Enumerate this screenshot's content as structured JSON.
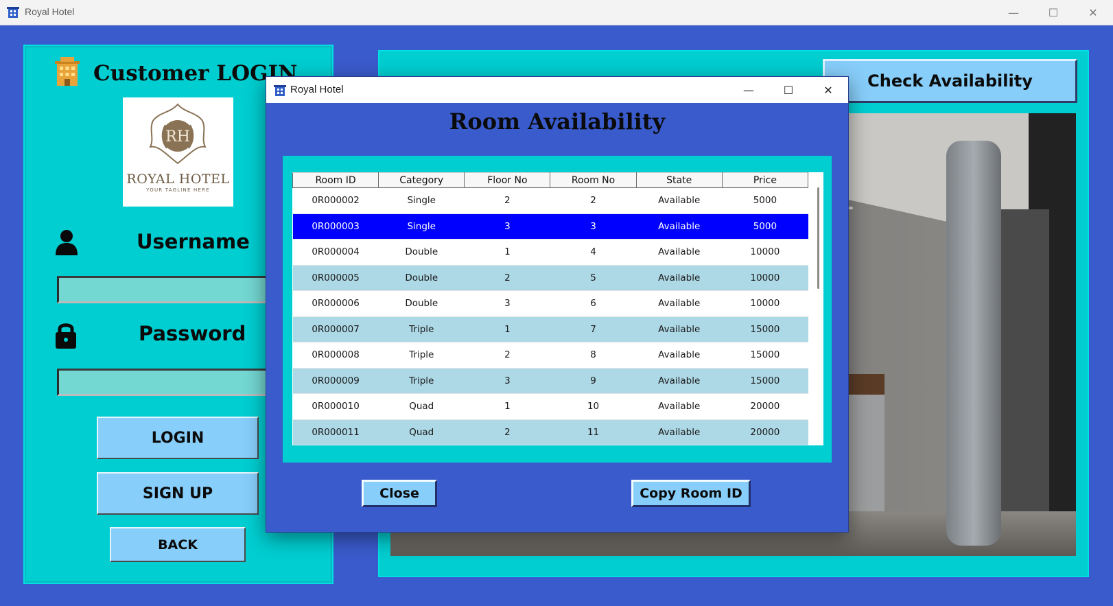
{
  "window": {
    "title": "Royal Hotel",
    "minimize_glyph": "—",
    "maximize_glyph": "☐",
    "close_glyph": "✕"
  },
  "login": {
    "title": "Customer LOGIN",
    "logo_monogram": "RH",
    "logo_name": "ROYAL HOTEL",
    "logo_tagline": "YOUR TAGLINE HERE",
    "username_label": "Username",
    "username_value": "",
    "password_label": "Password",
    "password_value": "",
    "login_button": "LOGIN",
    "signup_button": "SIGN UP",
    "back_button": "BACK"
  },
  "main": {
    "check_availability_button": "Check Availability"
  },
  "dialog": {
    "title": "Royal Hotel",
    "heading": "Room Availability",
    "columns": [
      "Room ID",
      "Category",
      "Floor No",
      "Room No",
      "State",
      "Price"
    ],
    "rows": [
      {
        "room_id": "0R000002",
        "category": "Single",
        "floor": "2",
        "room": "2",
        "state": "Available",
        "price": "5000"
      },
      {
        "room_id": "0R000003",
        "category": "Single",
        "floor": "3",
        "room": "3",
        "state": "Available",
        "price": "5000"
      },
      {
        "room_id": "0R000004",
        "category": "Double",
        "floor": "1",
        "room": "4",
        "state": "Available",
        "price": "10000"
      },
      {
        "room_id": "0R000005",
        "category": "Double",
        "floor": "2",
        "room": "5",
        "state": "Available",
        "price": "10000"
      },
      {
        "room_id": "0R000006",
        "category": "Double",
        "floor": "3",
        "room": "6",
        "state": "Available",
        "price": "10000"
      },
      {
        "room_id": "0R000007",
        "category": "Triple",
        "floor": "1",
        "room": "7",
        "state": "Available",
        "price": "15000"
      },
      {
        "room_id": "0R000008",
        "category": "Triple",
        "floor": "2",
        "room": "8",
        "state": "Available",
        "price": "15000"
      },
      {
        "room_id": "0R000009",
        "category": "Triple",
        "floor": "3",
        "room": "9",
        "state": "Available",
        "price": "15000"
      },
      {
        "room_id": "0R000010",
        "category": "Quad",
        "floor": "1",
        "room": "10",
        "state": "Available",
        "price": "20000"
      },
      {
        "room_id": "0R000011",
        "category": "Quad",
        "floor": "2",
        "room": "11",
        "state": "Available",
        "price": "20000"
      }
    ],
    "selected_row_index": 1,
    "close_button": "Close",
    "copy_button": "Copy Room ID"
  },
  "colors": {
    "background": "#3a5bcc",
    "panel": "#00ced1",
    "button": "#87cefa",
    "row_alt": "#add8e6",
    "row_selected": "#0000ff"
  }
}
